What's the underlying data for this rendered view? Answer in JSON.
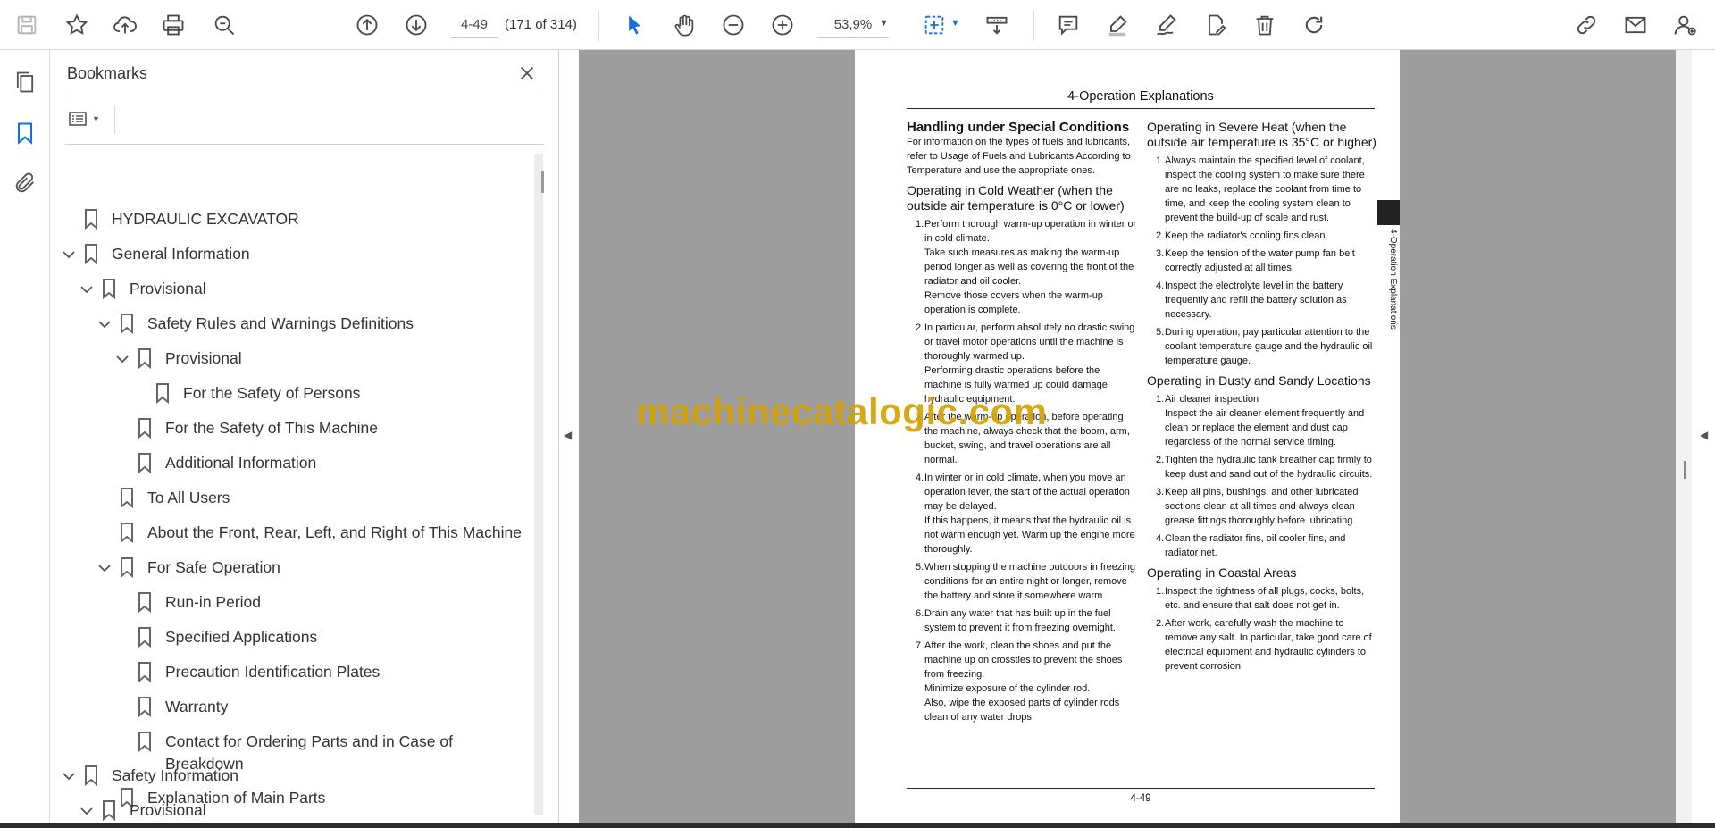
{
  "toolbar": {
    "page_current": "4-49",
    "page_of": "(171 of 314)",
    "zoom": "53,9%"
  },
  "bookmarks": {
    "title": "Bookmarks",
    "items": [
      {
        "label": "HYDRAULIC EXCAVATOR"
      },
      {
        "label": "General Information"
      },
      {
        "label": "Provisional"
      },
      {
        "label": "Safety Rules and Warnings Definitions"
      },
      {
        "label": "Provisional"
      },
      {
        "label": "For the Safety of Persons"
      },
      {
        "label": "For the Safety of This Machine"
      },
      {
        "label": "Additional Information"
      },
      {
        "label": "To All Users"
      },
      {
        "label": "About the Front, Rear, Left, and Right of This Machine"
      },
      {
        "label": "For Safe Operation"
      },
      {
        "label": "Run-in Period"
      },
      {
        "label": "Specified Applications"
      },
      {
        "label": "Precaution Identification Plates"
      },
      {
        "label": "Warranty"
      },
      {
        "label": "Contact for Ordering Parts and in Case of"
      },
      {
        "label": "Breakdown"
      },
      {
        "label": "Explanation of Main Parts"
      },
      {
        "label": "Safety Information"
      },
      {
        "label": "Provisional"
      }
    ]
  },
  "document": {
    "header": "4-Operation Explanations",
    "side_tab": "4-Operation Explanations",
    "page_number": "4-49",
    "watermark": "machinecatalogic.com",
    "left": {
      "title": "Handling under Special Conditions",
      "intro": "For information on the types of fuels and lubricants, refer to Usage of Fuels and Lubricants According to Temperature and use the appropriate ones.",
      "cold_heading": "Operating in Cold Weather (when the outside air temperature is 0°C or lower)",
      "cold_items": [
        {
          "n": "1.",
          "t": "Perform thorough warm-up operation in winter or in cold climate.",
          "sub": [
            "Take such measures as making the warm-up period longer as well as covering the front of the radiator and oil cooler.",
            "Remove those covers when the warm-up operation is complete."
          ]
        },
        {
          "n": "2.",
          "t": "In particular, perform absolutely no drastic swing or travel motor operations until the machine is thoroughly warmed up.",
          "sub": [
            "Performing drastic operations before the machine is fully warmed up could damage hydraulic equipment."
          ]
        },
        {
          "n": "3.",
          "t": "After the warm-up operation, before operating the machine, always check that the boom, arm, bucket, swing, and travel operations are all normal.",
          "sub": []
        },
        {
          "n": "4.",
          "t": "In winter or in cold climate, when you move an operation lever, the start of the actual operation may be delayed.",
          "sub": [
            "If this happens, it means that the hydraulic oil is not warm enough yet. Warm up the engine more thoroughly."
          ]
        },
        {
          "n": "5.",
          "t": "When stopping the machine outdoors in freezing conditions for an entire night or longer, remove the battery and store it somewhere warm.",
          "sub": []
        },
        {
          "n": "6.",
          "t": "Drain any water that has built up in the fuel system to prevent it from freezing overnight.",
          "sub": []
        },
        {
          "n": "7.",
          "t": "After the work, clean the shoes and put the machine up on crossties to prevent the shoes from freezing.",
          "sub": [
            "Minimize exposure of the cylinder rod.",
            "Also, wipe the exposed parts of cylinder rods clean of any water drops."
          ]
        }
      ]
    },
    "right": {
      "heat_heading": "Operating in Severe Heat (when the outside air temperature is 35°C or higher)",
      "heat_items": [
        {
          "n": "1.",
          "t": "Always maintain the specified level of coolant, inspect the cooling system to make sure there are no leaks, replace the coolant from time to time, and keep the cooling system clean to prevent the build-up of scale and rust."
        },
        {
          "n": "2.",
          "t": "Keep the radiator's cooling fins clean."
        },
        {
          "n": "3.",
          "t": "Keep the tension of the water pump fan belt correctly adjusted at all times."
        },
        {
          "n": "4.",
          "t": "Inspect the electrolyte level in the battery frequently and refill the battery solution as necessary."
        },
        {
          "n": "5.",
          "t": "During operation, pay particular attention to the coolant temperature gauge and the hydraulic oil temperature gauge."
        }
      ],
      "dust_heading": "Operating in Dusty and Sandy Locations",
      "dust_items": [
        {
          "n": "1.",
          "t": "Air cleaner inspection",
          "sub": [
            "Inspect the air cleaner element frequently and clean or replace the element and dust cap regardless of the normal service timing."
          ]
        },
        {
          "n": "2.",
          "t": "Tighten the hydraulic tank breather cap firmly to keep dust and sand out of the hydraulic circuits.",
          "sub": []
        },
        {
          "n": "3.",
          "t": "Keep all pins, bushings, and other lubricated sections clean at all times and always clean grease fittings thoroughly before lubricating.",
          "sub": []
        },
        {
          "n": "4.",
          "t": "Clean the radiator fins, oil cooler fins, and radiator net.",
          "sub": []
        }
      ],
      "coastal_heading": "Operating in Coastal Areas",
      "coastal_items": [
        {
          "n": "1.",
          "t": "Inspect the tightness of all plugs, cocks, bolts, etc. and ensure that salt does not get in."
        },
        {
          "n": "2.",
          "t": "After work, carefully wash the machine to remove any salt. In particular, take good care of electrical equipment and hydraulic cylinders to prevent corrosion."
        }
      ]
    }
  }
}
